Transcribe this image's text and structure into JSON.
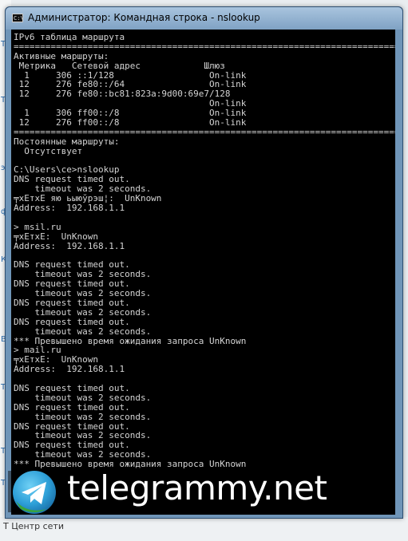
{
  "window": {
    "title": "Администратор: Командная строка - nslookup",
    "icon_label": "C:\\"
  },
  "console_lines": [
    "IPv6 таблица маршрута",
    "===========================================================================",
    "Активные маршруты:",
    " Метрика   Сетевой адрес            Шлюз",
    "  1     306 ::1/128                  On-link",
    " 12     276 fe80::/64                On-link",
    " 12     276 fe80::bc81:823a:9d00:69e7/128",
    "                                     On-link",
    "  1     306 ff00::/8                 On-link",
    " 12     276 ff00::/8                 On-link",
    "===========================================================================",
    "Постоянные маршруты:",
    "  Отсутствует",
    "",
    "C:\\Users\\ce>nslookup",
    "DNS request timed out.",
    "    timeout was 2 seconds.",
    "╤xEтxE яю ьыюўрэш¦:  UnKnown",
    "Address:  192.168.1.1",
    "",
    "> msil.ru",
    "╤xEтxE:  UnKnown",
    "Address:  192.168.1.1",
    "",
    "DNS request timed out.",
    "    timeout was 2 seconds.",
    "DNS request timed out.",
    "    timeout was 2 seconds.",
    "DNS request timed out.",
    "    timeout was 2 seconds.",
    "DNS request timed out.",
    "    timeout was 2 seconds.",
    "*** Превышено время ожидания запроса UnKnown",
    "> mail.ru",
    "╤xEтxE:  UnKnown",
    "Address:  192.168.1.1",
    "",
    "DNS request timed out.",
    "    timeout was 2 seconds.",
    "DNS request timed out.",
    "    timeout was 2 seconds.",
    "DNS request timed out.",
    "    timeout was 2 seconds.",
    "DNS request timed out.",
    "    timeout was 2 seconds.",
    "*** Превышено время ожидания запроса UnKnown"
  ],
  "background": {
    "left_fragments": [
      "Т",
      "Т",
      "э",
      "ф",
      "К",
      "В",
      "Т",
      "Т",
      "Т"
    ],
    "bottom_text": "Т  Центр сети"
  },
  "watermark": {
    "text": "telegrammy.net",
    "icon": "telegram-paper-plane-icon"
  },
  "colors": {
    "console_bg": "#000000",
    "console_fg": "#d4d4d4",
    "titlebar": "#8fb0d0",
    "watermark_text": "#ffffff",
    "logo_blue": "#2ea0d8",
    "logo_green": "#3aa53a"
  }
}
